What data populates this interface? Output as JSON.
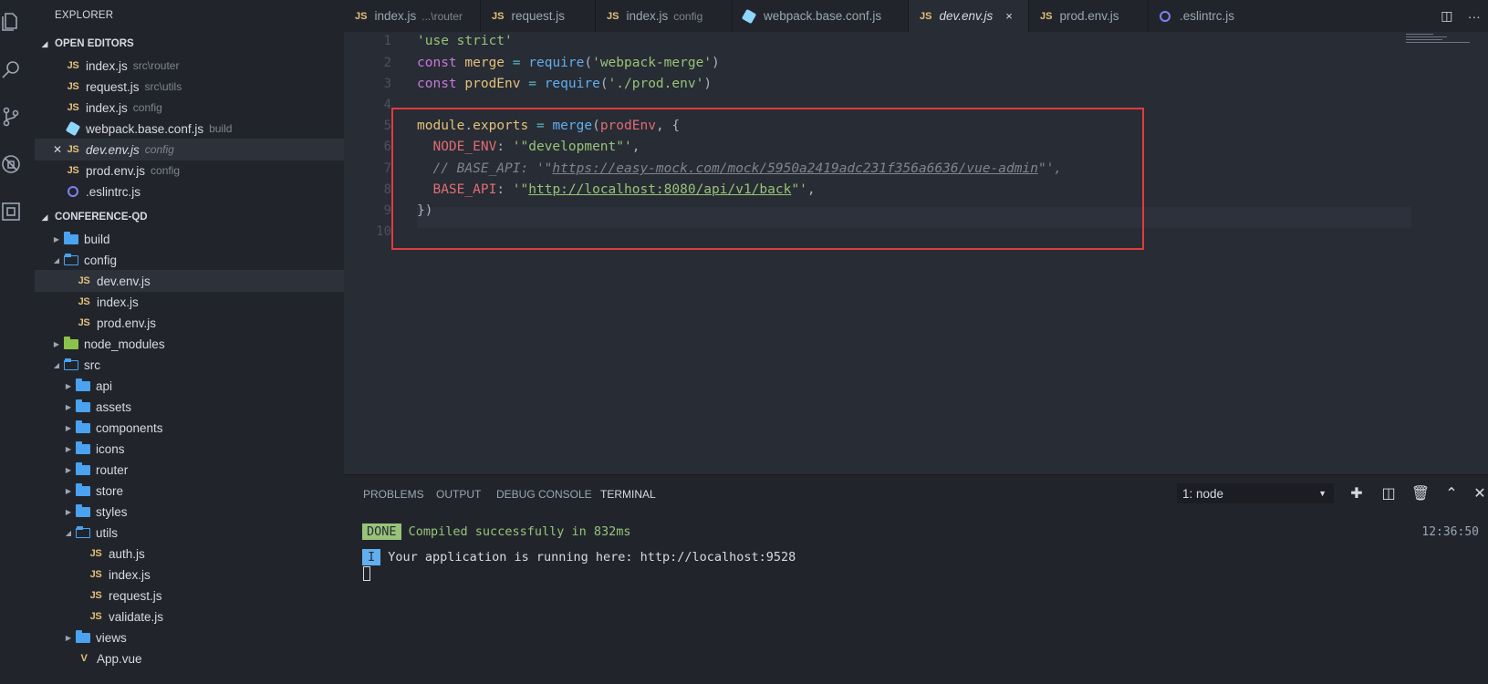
{
  "sidebar": {
    "title": "EXPLORER",
    "open_editors_label": "OPEN EDITORS",
    "open_editors": [
      {
        "name": "index.js",
        "hint": "src\\router",
        "icon": "js-icon"
      },
      {
        "name": "request.js",
        "hint": "src\\utils",
        "icon": "js-icon"
      },
      {
        "name": "index.js",
        "hint": "config",
        "icon": "js-icon"
      },
      {
        "name": "webpack.base.conf.js",
        "hint": "build",
        "icon": "webpack-icon"
      },
      {
        "name": "dev.env.js",
        "hint": "config",
        "icon": "js-icon"
      },
      {
        "name": "prod.env.js",
        "hint": "config",
        "icon": "js-icon"
      },
      {
        "name": ".eslintrc.js",
        "hint": "",
        "icon": "eslint-icon"
      }
    ],
    "project_label": "CONFERENCE-QD",
    "tree": [
      {
        "name": "build",
        "type": "folder"
      },
      {
        "name": "config",
        "type": "folder-open"
      },
      {
        "name": "dev.env.js",
        "type": "js"
      },
      {
        "name": "index.js",
        "type": "js"
      },
      {
        "name": "prod.env.js",
        "type": "js"
      },
      {
        "name": "node_modules",
        "type": "folder"
      },
      {
        "name": "src",
        "type": "folder-open"
      },
      {
        "name": "api",
        "type": "folder"
      },
      {
        "name": "assets",
        "type": "folder"
      },
      {
        "name": "components",
        "type": "folder"
      },
      {
        "name": "icons",
        "type": "folder"
      },
      {
        "name": "router",
        "type": "folder"
      },
      {
        "name": "store",
        "type": "folder"
      },
      {
        "name": "styles",
        "type": "folder"
      },
      {
        "name": "utils",
        "type": "folder-open"
      },
      {
        "name": "auth.js",
        "type": "js"
      },
      {
        "name": "index.js",
        "type": "js"
      },
      {
        "name": "request.js",
        "type": "js"
      },
      {
        "name": "validate.js",
        "type": "js"
      },
      {
        "name": "views",
        "type": "folder"
      },
      {
        "name": "App.vue",
        "type": "vue"
      }
    ]
  },
  "tabs": [
    {
      "name": "index.js",
      "hint": "...\\router",
      "icon": "js-icon"
    },
    {
      "name": "request.js",
      "hint": "",
      "icon": "js-icon"
    },
    {
      "name": "index.js",
      "hint": "config",
      "icon": "js-icon"
    },
    {
      "name": "webpack.base.conf.js",
      "hint": "",
      "icon": "webpack-icon"
    },
    {
      "name": "dev.env.js",
      "hint": "",
      "icon": "js-icon",
      "active": true,
      "close": "×"
    },
    {
      "name": "prod.env.js",
      "hint": "",
      "icon": "js-icon"
    },
    {
      "name": ".eslintrc.js",
      "hint": "",
      "icon": "eslint-icon"
    }
  ],
  "js_badge": "JS",
  "editor": {
    "line_numbers": [
      "1",
      "2",
      "3",
      "4",
      "5",
      "6",
      "7",
      "8",
      "9",
      "10"
    ],
    "code": {
      "l1_str": "'use strict'",
      "l2_kw": "const",
      "l2_var": "merge",
      "l2_op": " = ",
      "l2_fn": "require",
      "l2_open": "(",
      "l2_str": "'webpack-merge'",
      "l2_close": ")",
      "l3_kw": "const",
      "l3_var": "prodEnv",
      "l3_op": " = ",
      "l3_fn": "require",
      "l3_open": "(",
      "l3_str": "'./prod.env'",
      "l3_close": ")",
      "l5_obj": "module",
      "l5_dot": ".",
      "l5_prop": "exports",
      "l5_op": " = ",
      "l5_fn": "merge",
      "l5_open": "(",
      "l5_arg": "prodEnv",
      "l5_rest": ", {",
      "l6_key": "NODE_ENV",
      "l6_colon": ": ",
      "l6_str": "'\"development\"'",
      "l6_comma": ",",
      "l7_comment_a": "// BASE_API: '\"",
      "l7_comment_url": "https://easy-mock.com/mock/5950a2419adc231f356a6636/vue-admin",
      "l7_comment_b": "\"',",
      "l8_key": "BASE_API",
      "l8_colon": ": ",
      "l8_str_a": "'\"",
      "l8_url": "http://localhost:8080/api/v1/back",
      "l8_str_b": "\"'",
      "l8_comma": ",",
      "l9": "})"
    }
  },
  "panel": {
    "tabs": [
      "PROBLEMS",
      "OUTPUT",
      "DEBUG CONSOLE",
      "TERMINAL"
    ],
    "active_tab": "TERMINAL",
    "terminal_select": "1: node",
    "terminal": {
      "done_badge": "DONE",
      "done_text": "Compiled successfully in 832ms",
      "time": "12:36:50",
      "info_badge": "I",
      "info_text": "Your application is running here: http://localhost:9528"
    }
  },
  "colors": {
    "background": "#282c34",
    "sidebar": "#21252b",
    "highlight_box": "#e03c3c",
    "string": "#98c379",
    "keyword": "#c678dd",
    "function": "#61afef",
    "property": "#e06c75"
  }
}
